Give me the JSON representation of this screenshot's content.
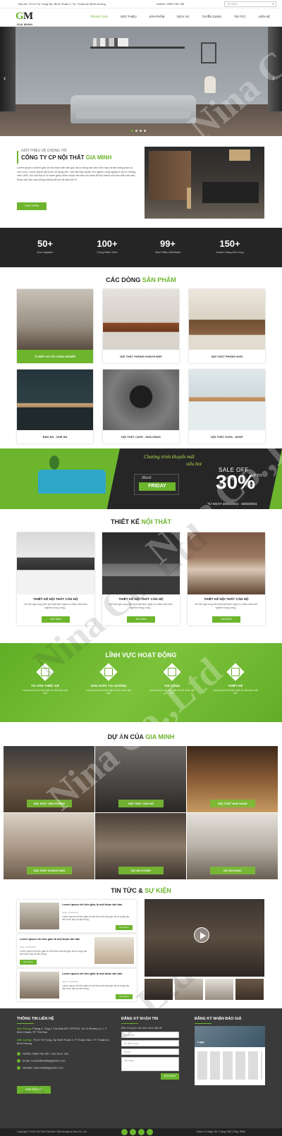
{
  "topbar": {
    "address": "Địa chỉ: 73 Lê Thị Trung Ấp, Bình Thuận 2, Tp. Thuận An Bình Dương",
    "hotline": "Hotline: 0908.796.789",
    "search_placeholder": "Tìm kiếm"
  },
  "logo": {
    "mark_g": "G",
    "mark_m": "M",
    "text": "GIA MINH"
  },
  "nav": [
    "TRANG CHỦ",
    "GIỚI THIỆU",
    "SẢN PHẨM",
    "DỊCH VỤ",
    "TUYỂN DỤNG",
    "TIN TỨC",
    "LIÊN HỆ"
  ],
  "about": {
    "subtitle": "GIỚI THIỆU VỀ CHÚNG TÔI",
    "title_a": "CÔNG TY CP NỘI THẤT ",
    "title_b": "GIA MINH",
    "text": "Lorem Ipsum chỉ đơn giản là một đoạn văn bản giả, được dùng vào việc trình bày và dàn trang phục vụ cho in ấn. Lorem Ipsum đã được sử dụng như một văn bản chuẩn cho ngành công nghiệp in ấn từ những năm 1500, khi một họa sĩ vô danh ghép nhiều đoạn văn bản với nhau để tạo thành một bản mẫu văn bản. Đoạn văn bản này không những đã tồn tại năm thế kỉ",
    "button": "XEM THÊM"
  },
  "stats": [
    {
      "value": "50+",
      "label": "Kinh Nghiệm"
    },
    {
      "value": "100+",
      "label": "Công Nhân Viên"
    },
    {
      "value": "99+",
      "label": "Sản Phẩm Mới/Năm"
    },
    {
      "value": "150+",
      "label": "Khách Hàng Hài Lòng"
    }
  ],
  "products": {
    "title_a": "CÁC DÒNG ",
    "title_b": "SẢN PHẨM",
    "items": [
      "TỦ BẾP GỖ GÕ CÔNG NGHIỆP",
      "NỘI THẤT PHÒNG KHÁCH ĐẸP",
      "NỘI THẤT PHÒNG NGỦ",
      "BÀN ĂN - GHẾ ĂN",
      "NỘI THẤT CAFE - NHÀ HÀNG",
      "NỘI THẤT SOFA - SHOP"
    ]
  },
  "banner": {
    "program_1": "Chương trình khuyến mãi",
    "program_2": "siêu hot",
    "black": "Black",
    "friday": "FRIDAY",
    "sale": "SALE OFF",
    "percent": "30%",
    "upto_1": "UP TO",
    "date": "TỪ NGÀY 26/02/2021 - 26/02/2021"
  },
  "designs": {
    "title_a": "THIẾT KẾ ",
    "title_b": "NỘI THẤT",
    "items": [
      {
        "title": "THIẾT KẾ NỘI THẤT CĂN HỘ",
        "desc": "Với đội ngũ công viên kỹ thuật lành nghề có nhiều năm kinh nghiệm trong công...",
        "btn": "Xem thêm"
      },
      {
        "title": "THIẾT KẾ NỘI THẤT CĂN HỘ",
        "desc": "Với đội ngũ công viên kỹ thuật lành nghề có nhiều năm kinh nghiệm trong công...",
        "btn": "Xem thêm"
      },
      {
        "title": "THIẾT KẾ NỘI THẤT CĂN HỘ",
        "desc": "Với đội ngũ công viên kỹ thuật lành nghề có nhiều năm kinh nghiệm trong công...",
        "btn": "Xem thêm"
      }
    ]
  },
  "fields": {
    "title": "LĨNH VỰC HOẠT ĐỘNG",
    "items": [
      {
        "title": "TƯ VẤN THIẾT KẾ",
        "desc": "Lorem Ipsum chỉ đơn giản là một đoạn văn bản"
      },
      {
        "title": "SẢN XUẤT TẠI XƯỞNG",
        "desc": "Lorem Ipsum chỉ đơn giản là một đoạn văn bản"
      },
      {
        "title": "THI CÔNG",
        "desc": "Lorem Ipsum chỉ đơn giản là một đoạn văn bản"
      },
      {
        "title": "THIẾT KẾ",
        "desc": "Lorem Ipsum chỉ đơn giản là một đoạn văn bản"
      }
    ]
  },
  "projects": {
    "title_a": "DỰ ÁN CỦA ",
    "title_b": "GIA MINH",
    "items": [
      "NỘI THẤT VĂN PHÒNG",
      "NỘI THẤT CĂN HỘ",
      "NỘI THẤT NHÀ HÀNG",
      "NỘI THẤT KHÁCH SẠN",
      "DỰ ÁN STORE",
      "DỰ ÁN KHÁC"
    ]
  },
  "news": {
    "title_a": "TIN TỨC & ",
    "title_b": "SỰ KIỆN",
    "items": [
      {
        "title": "Lorem Ipsum chỉ đơn giản là một đoạn văn bản",
        "date": "Ngày: 26/02/2021",
        "desc": "Lorem Ipsum chỉ đơn giản là một đoạn văn bản giả, được dùng vào việc trình bày và dàn trang...",
        "btn": "Xem thêm"
      },
      {
        "title": "Lorem Ipsum chỉ đơn giản là một đoạn văn bản",
        "date": "Ngày: 26/02/2021",
        "desc": "Lorem Ipsum chỉ đơn giản là một đoạn văn bản giả, được dùng vào việc trình bày và dàn trang...",
        "btn": "Xem thêm"
      },
      {
        "title": "Lorem Ipsum chỉ đơn giản là một đoạn văn bản",
        "date": "Ngày: 26/02/2021",
        "desc": "Lorem Ipsum chỉ đơn giản là một đoạn văn bản giả, được dùng vào việc trình bày và dàn trang...",
        "btn": "Xem thêm"
      }
    ]
  },
  "footer": {
    "contact_title": "THÔNG TIN LIÊN HỆ",
    "office_label": "Văn Phòng:",
    "office": "Phòng 4, Tầng 1 Tòa Nhà SKY OFFICE, Số 12 Đường số 2, P. Bình Chánh, TP. Thủ Đức",
    "factory_label": "Nhà xưởng:",
    "factory": "73 Lê Thị Trung, Ấp Bình Thuận 2, P. Thuận Giao, TP. Thuận An, Bình Dương",
    "hotline": "Hotline: 0908.796.789 - Liên hệ tư vấn",
    "email": "Email: contact@noithatgiaminh.com",
    "website": "Website: www.noithatgiaminh.com",
    "map_btn": "XEM BẢN ĐỒ",
    "subscribe_title": "ĐĂNG KÝ NHẬN TIN",
    "subscribe_desc": "Điền thông tin vào form dưới đây để",
    "name_ph": "Họ và tên",
    "phone_ph": "Số điện thoại",
    "email_ph": "Email",
    "content_ph": "Nội dung",
    "submit": "GỬI NGAY",
    "quote_title": "ĐĂNG KÝ NHẬN BÁO GIÁ",
    "fb_page": "Logo"
  },
  "bottom": {
    "copyright": "Copyright © 2021 Nội Thất Gia Minh. Web design by Nina Co.,Ltd",
    "stats": "Online: 8   |   Ngày: 56   |   Tháng: 985   |   Tổng: 9856"
  },
  "watermark": "Nina Co.,Ltd",
  "colors": {
    "accent": "#6cb52d",
    "dark": "#252525",
    "footer": "#3a3a3a"
  }
}
